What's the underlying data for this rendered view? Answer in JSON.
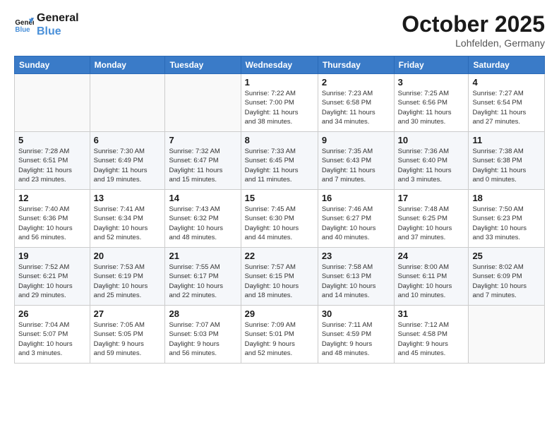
{
  "logo": {
    "line1": "General",
    "line2": "Blue"
  },
  "title": "October 2025",
  "location": "Lohfelden, Germany",
  "weekdays": [
    "Sunday",
    "Monday",
    "Tuesday",
    "Wednesday",
    "Thursday",
    "Friday",
    "Saturday"
  ],
  "weeks": [
    [
      {
        "day": "",
        "info": ""
      },
      {
        "day": "",
        "info": ""
      },
      {
        "day": "",
        "info": ""
      },
      {
        "day": "1",
        "info": "Sunrise: 7:22 AM\nSunset: 7:00 PM\nDaylight: 11 hours\nand 38 minutes."
      },
      {
        "day": "2",
        "info": "Sunrise: 7:23 AM\nSunset: 6:58 PM\nDaylight: 11 hours\nand 34 minutes."
      },
      {
        "day": "3",
        "info": "Sunrise: 7:25 AM\nSunset: 6:56 PM\nDaylight: 11 hours\nand 30 minutes."
      },
      {
        "day": "4",
        "info": "Sunrise: 7:27 AM\nSunset: 6:54 PM\nDaylight: 11 hours\nand 27 minutes."
      }
    ],
    [
      {
        "day": "5",
        "info": "Sunrise: 7:28 AM\nSunset: 6:51 PM\nDaylight: 11 hours\nand 23 minutes."
      },
      {
        "day": "6",
        "info": "Sunrise: 7:30 AM\nSunset: 6:49 PM\nDaylight: 11 hours\nand 19 minutes."
      },
      {
        "day": "7",
        "info": "Sunrise: 7:32 AM\nSunset: 6:47 PM\nDaylight: 11 hours\nand 15 minutes."
      },
      {
        "day": "8",
        "info": "Sunrise: 7:33 AM\nSunset: 6:45 PM\nDaylight: 11 hours\nand 11 minutes."
      },
      {
        "day": "9",
        "info": "Sunrise: 7:35 AM\nSunset: 6:43 PM\nDaylight: 11 hours\nand 7 minutes."
      },
      {
        "day": "10",
        "info": "Sunrise: 7:36 AM\nSunset: 6:40 PM\nDaylight: 11 hours\nand 3 minutes."
      },
      {
        "day": "11",
        "info": "Sunrise: 7:38 AM\nSunset: 6:38 PM\nDaylight: 11 hours\nand 0 minutes."
      }
    ],
    [
      {
        "day": "12",
        "info": "Sunrise: 7:40 AM\nSunset: 6:36 PM\nDaylight: 10 hours\nand 56 minutes."
      },
      {
        "day": "13",
        "info": "Sunrise: 7:41 AM\nSunset: 6:34 PM\nDaylight: 10 hours\nand 52 minutes."
      },
      {
        "day": "14",
        "info": "Sunrise: 7:43 AM\nSunset: 6:32 PM\nDaylight: 10 hours\nand 48 minutes."
      },
      {
        "day": "15",
        "info": "Sunrise: 7:45 AM\nSunset: 6:30 PM\nDaylight: 10 hours\nand 44 minutes."
      },
      {
        "day": "16",
        "info": "Sunrise: 7:46 AM\nSunset: 6:27 PM\nDaylight: 10 hours\nand 40 minutes."
      },
      {
        "day": "17",
        "info": "Sunrise: 7:48 AM\nSunset: 6:25 PM\nDaylight: 10 hours\nand 37 minutes."
      },
      {
        "day": "18",
        "info": "Sunrise: 7:50 AM\nSunset: 6:23 PM\nDaylight: 10 hours\nand 33 minutes."
      }
    ],
    [
      {
        "day": "19",
        "info": "Sunrise: 7:52 AM\nSunset: 6:21 PM\nDaylight: 10 hours\nand 29 minutes."
      },
      {
        "day": "20",
        "info": "Sunrise: 7:53 AM\nSunset: 6:19 PM\nDaylight: 10 hours\nand 25 minutes."
      },
      {
        "day": "21",
        "info": "Sunrise: 7:55 AM\nSunset: 6:17 PM\nDaylight: 10 hours\nand 22 minutes."
      },
      {
        "day": "22",
        "info": "Sunrise: 7:57 AM\nSunset: 6:15 PM\nDaylight: 10 hours\nand 18 minutes."
      },
      {
        "day": "23",
        "info": "Sunrise: 7:58 AM\nSunset: 6:13 PM\nDaylight: 10 hours\nand 14 minutes."
      },
      {
        "day": "24",
        "info": "Sunrise: 8:00 AM\nSunset: 6:11 PM\nDaylight: 10 hours\nand 10 minutes."
      },
      {
        "day": "25",
        "info": "Sunrise: 8:02 AM\nSunset: 6:09 PM\nDaylight: 10 hours\nand 7 minutes."
      }
    ],
    [
      {
        "day": "26",
        "info": "Sunrise: 7:04 AM\nSunset: 5:07 PM\nDaylight: 10 hours\nand 3 minutes."
      },
      {
        "day": "27",
        "info": "Sunrise: 7:05 AM\nSunset: 5:05 PM\nDaylight: 9 hours\nand 59 minutes."
      },
      {
        "day": "28",
        "info": "Sunrise: 7:07 AM\nSunset: 5:03 PM\nDaylight: 9 hours\nand 56 minutes."
      },
      {
        "day": "29",
        "info": "Sunrise: 7:09 AM\nSunset: 5:01 PM\nDaylight: 9 hours\nand 52 minutes."
      },
      {
        "day": "30",
        "info": "Sunrise: 7:11 AM\nSunset: 4:59 PM\nDaylight: 9 hours\nand 48 minutes."
      },
      {
        "day": "31",
        "info": "Sunrise: 7:12 AM\nSunset: 4:58 PM\nDaylight: 9 hours\nand 45 minutes."
      },
      {
        "day": "",
        "info": ""
      }
    ]
  ]
}
